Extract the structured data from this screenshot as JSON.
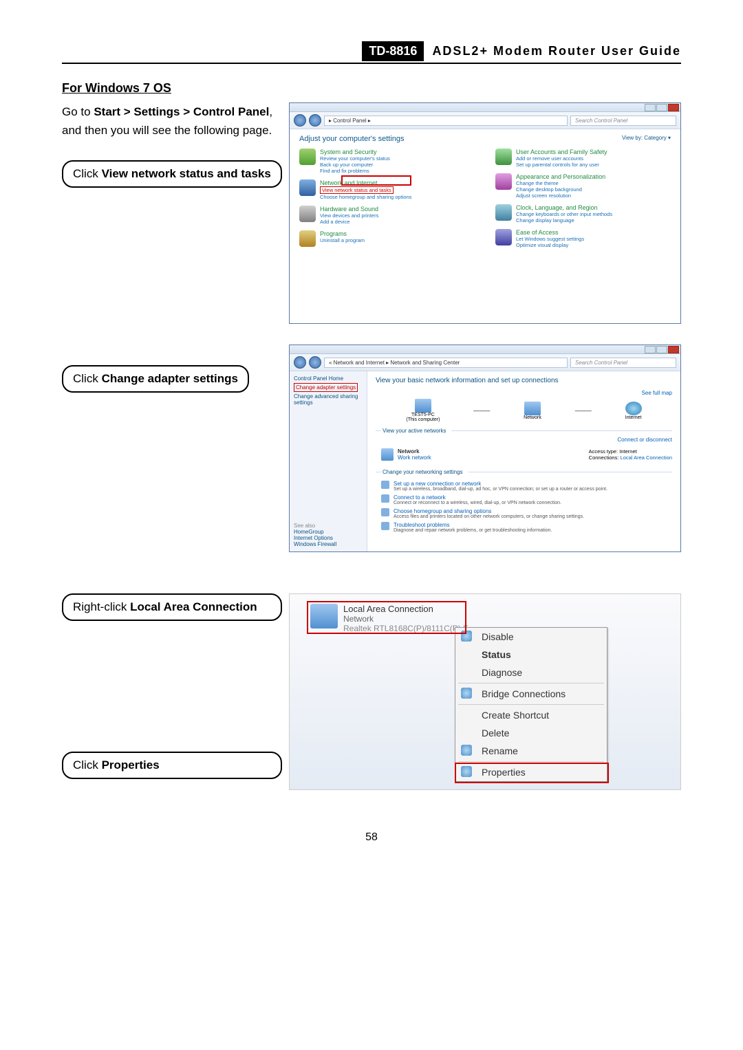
{
  "header": {
    "model": "TD-8816",
    "title": "ADSL2+  Modem  Router  User  Guide"
  },
  "section": "For Windows 7 OS",
  "step1_pre": "Go to ",
  "step1_bold": "Start > Settings > Control Panel",
  "step1_post": ", and then you will see the following page.",
  "callout1_pre": "Click ",
  "callout1_bold": "View network status and tasks",
  "callout2_pre": "Click ",
  "callout2_bold": "Change adapter settings",
  "callout3_pre": "Right-click ",
  "callout3_bold": "Local Area Connection",
  "callout4_pre": "Click ",
  "callout4_bold": "Properties",
  "pagenum": "58",
  "cp": {
    "path": "▸  Control Panel  ▸",
    "search": "Search Control Panel",
    "heading": "Adjust your computer's settings",
    "viewby": "View by:  Category ▾",
    "items_left": [
      {
        "t": "System and Security",
        "s": [
          "Review your computer's status",
          "Back up your computer",
          "Find and fix problems"
        ],
        "ic": "sys"
      },
      {
        "t": "Network and Internet",
        "s": [
          "View network status and tasks",
          "Choose homegroup and sharing options"
        ],
        "ic": "net",
        "hl": 0
      },
      {
        "t": "Hardware and Sound",
        "s": [
          "View devices and printers",
          "Add a device"
        ],
        "ic": "hw"
      },
      {
        "t": "Programs",
        "s": [
          "Uninstall a program"
        ],
        "ic": "prog"
      }
    ],
    "items_right": [
      {
        "t": "User Accounts and Family Safety",
        "s": [
          "Add or remove user accounts",
          "Set up parental controls for any user"
        ],
        "ic": "user"
      },
      {
        "t": "Appearance and Personalization",
        "s": [
          "Change the theme",
          "Change desktop background",
          "Adjust screen resolution"
        ],
        "ic": "appr"
      },
      {
        "t": "Clock, Language, and Region",
        "s": [
          "Change keyboards or other input methods",
          "Change display language"
        ],
        "ic": "clock"
      },
      {
        "t": "Ease of Access",
        "s": [
          "Let Windows suggest settings",
          "Optimize visual display"
        ],
        "ic": "ease"
      }
    ]
  },
  "ns": {
    "path": "« Network and Internet ▸ Network and Sharing Center",
    "search": "Search Control Panel",
    "side_home": "Control Panel Home",
    "side_change_adapter": "Change adapter settings",
    "side_change_adv": "Change advanced sharing settings",
    "side_seealso": "See also",
    "side_links": [
      "HomeGroup",
      "Internet Options",
      "Windows Firewall"
    ],
    "heading": "View your basic network information and set up connections",
    "fullmap": "See full map",
    "pc": "TEST5-PC",
    "pc_sub": "(This computer)",
    "net": "Network",
    "inet": "Internet",
    "view_active": "View your active networks",
    "conn_disc": "Connect or disconnect",
    "netname": "Network",
    "nettype": "Work network",
    "access_l": "Access type:",
    "access_v": "Internet",
    "conns_l": "Connections:",
    "conns_v": "Local Area Connection",
    "change_sect": "Change your networking settings",
    "opts": [
      {
        "t": "Set up a new connection or network",
        "s": "Set up a wireless, broadband, dial-up, ad hoc, or VPN connection; or set up a router or access point."
      },
      {
        "t": "Connect to a network",
        "s": "Connect or reconnect to a wireless, wired, dial-up, or VPN network connection."
      },
      {
        "t": "Choose homegroup and sharing options",
        "s": "Access files and printers located on other network computers, or change sharing settings."
      },
      {
        "t": "Troubleshoot problems",
        "s": "Diagnose and repair network problems, or get troubleshooting information."
      }
    ]
  },
  "conn": {
    "name": "Local Area Connection",
    "sub1": "Network",
    "sub2": "Realtek RTL8168C(P)/8111C(P) F...",
    "menu": [
      "Disable",
      "Status",
      "Diagnose",
      "—",
      "Bridge Connections",
      "—",
      "Create Shortcut",
      "Delete",
      "Rename",
      "—",
      "Properties"
    ]
  }
}
